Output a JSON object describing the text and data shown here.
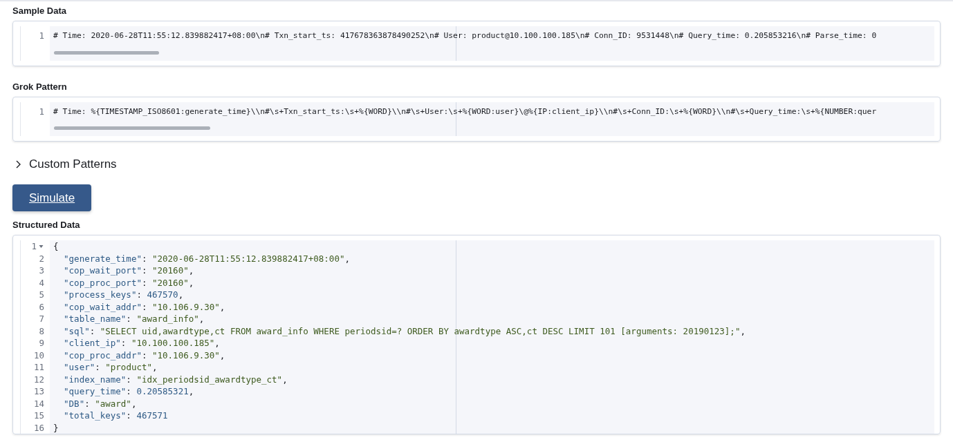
{
  "sample_data": {
    "label": "Sample Data",
    "lines": [
      {
        "number": "1",
        "tokens": [
          {
            "kind": "plain",
            "text": "# Time: 2020-06-28T11:55:12.839882417+08:00\\n# Txn_start_ts: 417678363878490252\\n# User: product@10.100.100.185\\n# Conn_ID: 9531448\\n# Query_time: 0.205853216\\n# Parse_time: 0"
          }
        ]
      }
    ]
  },
  "grok_pattern": {
    "label": "Grok Pattern",
    "lines": [
      {
        "number": "1",
        "tokens": [
          {
            "kind": "plain",
            "text": "# Time: %{TIMESTAMP_ISO8601:generate_time}\\\\n#\\s+Txn_start_ts:\\s+%{WORD}\\\\n#\\s+User:\\s+%{WORD:user}\\@%{IP:client_ip}\\\\n#\\s+Conn_ID:\\s+%{WORD}\\\\n#\\s+Query_time:\\s+%{NUMBER:quer"
          }
        ]
      }
    ]
  },
  "custom_patterns": {
    "label": "Custom Patterns",
    "expanded": false
  },
  "simulate_button": {
    "label": "Simulate"
  },
  "structured_data": {
    "label": "Structured Data",
    "lines": [
      {
        "number": "1",
        "fold": {
          "expanded": true
        },
        "tokens": [
          {
            "kind": "plain",
            "text": "{"
          }
        ]
      },
      {
        "number": "2",
        "tokens": [
          {
            "kind": "key",
            "text": "  \"generate_time\""
          },
          {
            "kind": "plain",
            "text": ": "
          },
          {
            "kind": "string",
            "text": "\"2020-06-28T11:55:12.839882417+08:00\""
          },
          {
            "kind": "plain",
            "text": ","
          }
        ]
      },
      {
        "number": "3",
        "tokens": [
          {
            "kind": "key",
            "text": "  \"cop_wait_port\""
          },
          {
            "kind": "plain",
            "text": ": "
          },
          {
            "kind": "string",
            "text": "\"20160\""
          },
          {
            "kind": "plain",
            "text": ","
          }
        ]
      },
      {
        "number": "4",
        "tokens": [
          {
            "kind": "key",
            "text": "  \"cop_proc_port\""
          },
          {
            "kind": "plain",
            "text": ": "
          },
          {
            "kind": "string",
            "text": "\"20160\""
          },
          {
            "kind": "plain",
            "text": ","
          }
        ]
      },
      {
        "number": "5",
        "tokens": [
          {
            "kind": "key",
            "text": "  \"process_keys\""
          },
          {
            "kind": "plain",
            "text": ": "
          },
          {
            "kind": "number",
            "text": "467570"
          },
          {
            "kind": "plain",
            "text": ","
          }
        ]
      },
      {
        "number": "6",
        "tokens": [
          {
            "kind": "key",
            "text": "  \"cop_wait_addr\""
          },
          {
            "kind": "plain",
            "text": ": "
          },
          {
            "kind": "string",
            "text": "\"10.106.9.30\""
          },
          {
            "kind": "plain",
            "text": ","
          }
        ]
      },
      {
        "number": "7",
        "tokens": [
          {
            "kind": "key",
            "text": "  \"table_name\""
          },
          {
            "kind": "plain",
            "text": ": "
          },
          {
            "kind": "string",
            "text": "\"award_info\""
          },
          {
            "kind": "plain",
            "text": ","
          }
        ]
      },
      {
        "number": "8",
        "tokens": [
          {
            "kind": "key",
            "text": "  \"sql\""
          },
          {
            "kind": "plain",
            "text": ": "
          },
          {
            "kind": "string",
            "text": "\"SELECT uid,awardtype,ct FROM award_info WHERE periodsid=? ORDER BY awardtype ASC,ct DESC LIMIT 101 [arguments: 20190123];\""
          },
          {
            "kind": "plain",
            "text": ","
          }
        ]
      },
      {
        "number": "9",
        "tokens": [
          {
            "kind": "key",
            "text": "  \"client_ip\""
          },
          {
            "kind": "plain",
            "text": ": "
          },
          {
            "kind": "string",
            "text": "\"10.100.100.185\""
          },
          {
            "kind": "plain",
            "text": ","
          }
        ]
      },
      {
        "number": "10",
        "tokens": [
          {
            "kind": "key",
            "text": "  \"cop_proc_addr\""
          },
          {
            "kind": "plain",
            "text": ": "
          },
          {
            "kind": "string",
            "text": "\"10.106.9.30\""
          },
          {
            "kind": "plain",
            "text": ","
          }
        ]
      },
      {
        "number": "11",
        "tokens": [
          {
            "kind": "key",
            "text": "  \"user\""
          },
          {
            "kind": "plain",
            "text": ": "
          },
          {
            "kind": "string",
            "text": "\"product\""
          },
          {
            "kind": "plain",
            "text": ","
          }
        ]
      },
      {
        "number": "12",
        "tokens": [
          {
            "kind": "key",
            "text": "  \"index_name\""
          },
          {
            "kind": "plain",
            "text": ": "
          },
          {
            "kind": "string",
            "text": "\"idx_periodsid_awardtype_ct\""
          },
          {
            "kind": "plain",
            "text": ","
          }
        ]
      },
      {
        "number": "13",
        "tokens": [
          {
            "kind": "key",
            "text": "  \"query_time\""
          },
          {
            "kind": "plain",
            "text": ": "
          },
          {
            "kind": "number",
            "text": "0.20585321"
          },
          {
            "kind": "plain",
            "text": ","
          }
        ]
      },
      {
        "number": "14",
        "tokens": [
          {
            "kind": "key",
            "text": "  \"DB\""
          },
          {
            "kind": "plain",
            "text": ": "
          },
          {
            "kind": "string",
            "text": "\"award\""
          },
          {
            "kind": "plain",
            "text": ","
          }
        ]
      },
      {
        "number": "15",
        "tokens": [
          {
            "kind": "key",
            "text": "  \"total_keys\""
          },
          {
            "kind": "plain",
            "text": ": "
          },
          {
            "kind": "number",
            "text": "467571"
          }
        ]
      },
      {
        "number": "16",
        "tokens": [
          {
            "kind": "plain",
            "text": "}"
          }
        ]
      }
    ]
  }
}
